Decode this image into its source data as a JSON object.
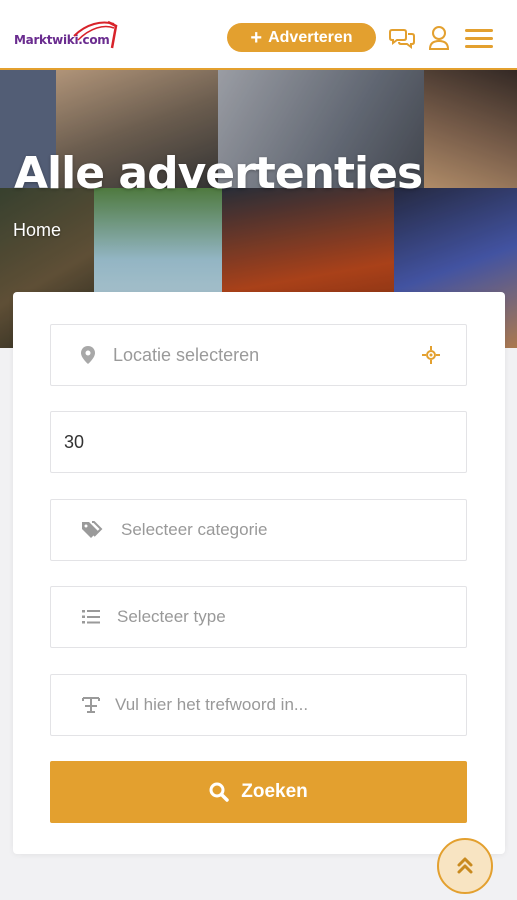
{
  "header": {
    "logo_text": "Marktwiki.com",
    "post_button_label": "Adverteren",
    "icons": [
      "chat-icon",
      "user-icon",
      "menu-icon"
    ]
  },
  "hero": {
    "title": "Alle advertenties",
    "breadcrumb": "Home"
  },
  "search": {
    "location_placeholder": "Locatie selecteren",
    "radius_value": "30",
    "category_placeholder": "Selecteer categorie",
    "type_placeholder": "Selecteer type",
    "keyword_placeholder": "Vul hier het trefwoord in...",
    "submit_label": "Zoeken"
  },
  "colors": {
    "accent": "#e3a02f",
    "brand": "#6a2c8f"
  }
}
